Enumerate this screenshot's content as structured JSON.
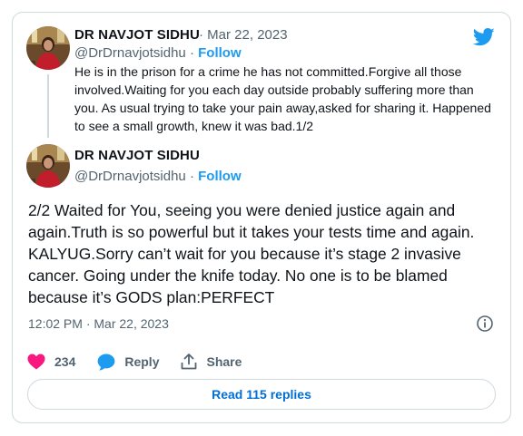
{
  "quoted_tweet": {
    "author_name": "DR NAVJOT SIDHU",
    "dot": "·",
    "date": "Mar 22, 2023",
    "handle": "@DrDrnavjotsidhu",
    "follow_label": "Follow",
    "text": "He is in the prison for a crime he has not committed.Forgive all those involved.Waiting for you each day outside probably suffering more than you. As usual trying to take your pain away,asked for sharing it. Happened to see a small growth, knew it was bad.1/2"
  },
  "main_tweet": {
    "author_name": "DR NAVJOT SIDHU",
    "handle": "@DrDrnavjotsidhu",
    "dot": "·",
    "follow_label": "Follow",
    "text": "2/2 Waited for You, seeing you were denied justice again and again.Truth is so powerful but it takes your tests time and again. KALYUG.Sorry can’t wait for you because it’s stage 2 invasive cancer. Going under the knife today. No one is to be blamed because it’s GODS plan:PERFECT",
    "timestamp": "12:02 PM · Mar 22, 2023"
  },
  "actions": {
    "like_count": "234",
    "reply_label": "Reply",
    "share_label": "Share"
  },
  "read_replies_label": "Read 115 replies",
  "icons": [
    "twitter-bird-icon",
    "heart-icon",
    "reply-bubble-icon",
    "share-icon",
    "info-icon"
  ],
  "colors": {
    "accent": "#1d9bf0",
    "like": "#f91880",
    "text": "#0f1419",
    "muted": "#536471",
    "border": "#cfd9de"
  }
}
